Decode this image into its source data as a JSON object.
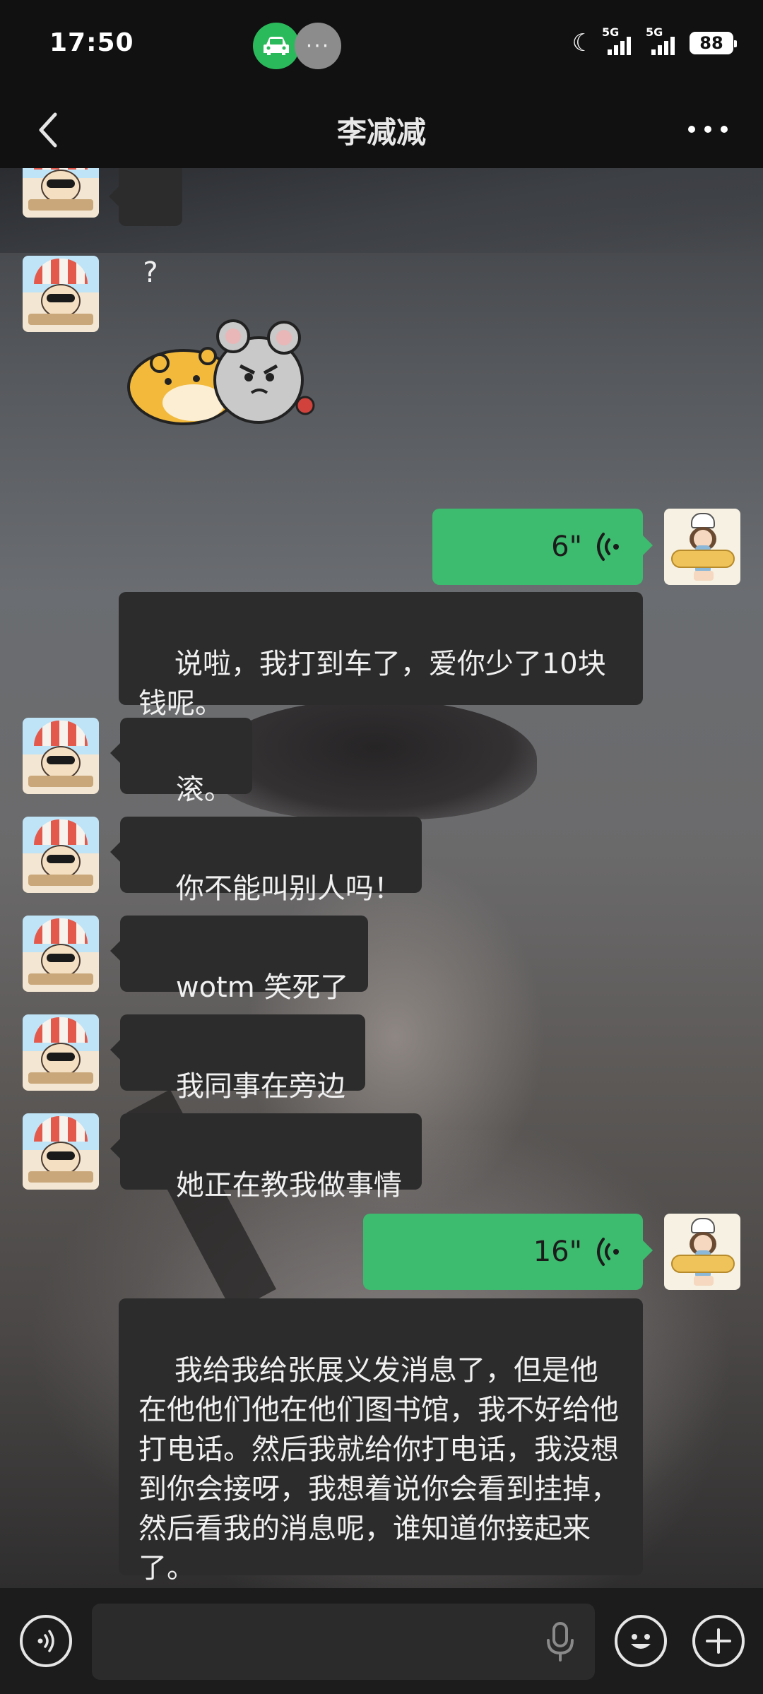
{
  "status_bar": {
    "time": "17:50",
    "network_1": "5G",
    "network_2": "5G",
    "battery": "88",
    "icons": [
      "car-icon",
      "more-dots-icon",
      "moon-icon",
      "signal-icon",
      "battery-icon"
    ]
  },
  "header": {
    "title": "李减减",
    "back_icon": "chevron-left-icon",
    "menu_icon": "more-horizontal-icon"
  },
  "messages": [
    {
      "sender": "friend",
      "type": "text",
      "text": "?"
    },
    {
      "sender": "friend",
      "type": "sticker",
      "sticker": "hamster-and-mouse-sticker"
    },
    {
      "sender": "me",
      "type": "voice",
      "duration": "6\"",
      "transcript": "说啦，我打到车了，爱你少了10块钱呢。"
    },
    {
      "sender": "friend",
      "type": "text",
      "text": "滚。"
    },
    {
      "sender": "friend",
      "type": "text",
      "text": "你不能叫别人吗！"
    },
    {
      "sender": "friend",
      "type": "text",
      "text": "wotm 笑死了"
    },
    {
      "sender": "friend",
      "type": "text",
      "text": "我同事在旁边"
    },
    {
      "sender": "friend",
      "type": "text",
      "text": "她正在教我做事情"
    },
    {
      "sender": "me",
      "type": "voice",
      "duration": "16\"",
      "transcript": "我给我给张展义发消息了，但是他在他他们他在他们图书馆，我不好给他打电话。然后我就给你打电话，我没想到你会接呀，我想着说你会看到挂掉，然后看我的消息呢，谁知道你接起来了。"
    }
  ],
  "input_bar": {
    "placeholder": "",
    "icons": [
      "voice-mode-icon",
      "microphone-icon",
      "emoji-icon",
      "plus-icon"
    ]
  },
  "colors": {
    "voice_bubble": "#3dbb6e",
    "text_bubble": "#2c2c2c",
    "bar_background": "#111111"
  }
}
